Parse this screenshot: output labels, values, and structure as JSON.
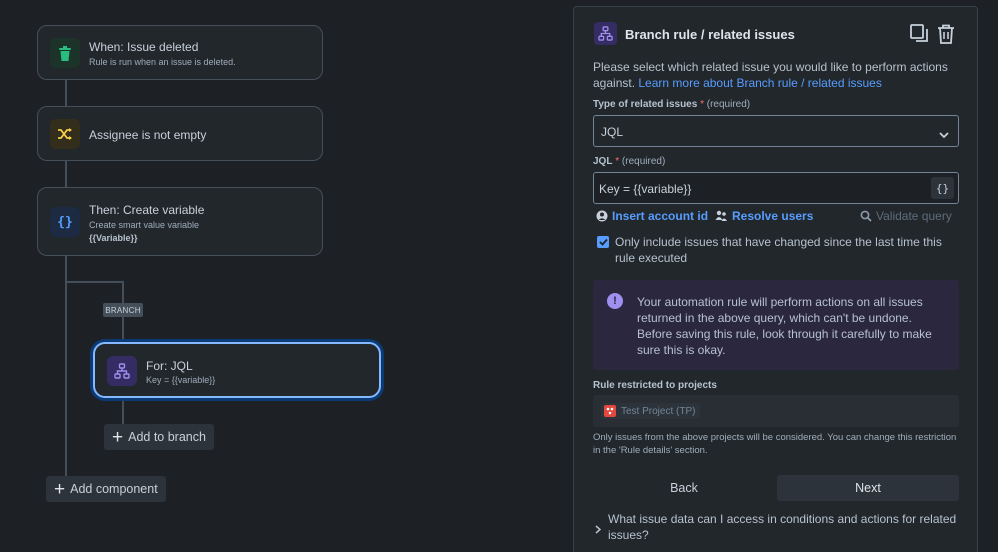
{
  "canvas": {
    "trigger": {
      "title": "When: Issue deleted",
      "subtitle": "Rule is run when an issue is deleted.",
      "icon": "trash-icon",
      "icon_color": "#2abb7f"
    },
    "condition": {
      "title": "Assignee is not empty",
      "icon": "shuffle-icon",
      "icon_color": "#f5cd47"
    },
    "action": {
      "title": "Then: Create variable",
      "subtitle": "Create smart value variable",
      "subtitle2": "{{Variable}}",
      "icon": "braces-icon",
      "icon_color": "#579dff"
    },
    "branch_tag": "BRANCH",
    "branch_node": {
      "title": "For: JQL",
      "subtitle": "Key = {{variable}}",
      "icon": "hierarchy-icon",
      "icon_color": "#9f8fef"
    },
    "add_to_branch": "Add to branch",
    "add_component": "Add component"
  },
  "panel": {
    "title": "Branch rule / related issues",
    "description": "Please select which related issue you would like to perform actions against.",
    "learn_more": "Learn more about Branch rule / related issues",
    "type_label": "Type of related issues",
    "required_star": "*",
    "required_text": "(required)",
    "type_value": "JQL",
    "jql_label": "JQL",
    "jql_value": "Key = {{variable}}",
    "jql_braces": "{}",
    "insert_account": "Insert account id",
    "resolve_users": "Resolve users",
    "validate_query": "Validate query",
    "checkbox_checked": true,
    "checkbox_text": "Only include issues that have changed since the last time this rule executed",
    "info_icon": "!",
    "info_text": "Your automation rule will perform actions on all issues returned in the above query, which can't be undone. Before saving this rule, look through it carefully to make sure this is okay.",
    "projects_label": "Rule restricted to projects",
    "project_chip": "Test Project (TP)",
    "helper_text": "Only issues from the above projects will be considered. You can change this restriction in the 'Rule details' section.",
    "back": "Back",
    "next": "Next",
    "faq": "What issue data can I access in conditions and actions for related issues?"
  },
  "colors": {
    "background": "#1d2125",
    "surface": "#22272b",
    "accent": "#579dff",
    "focus": "#85b8ff",
    "discovery": "#9f8fef"
  }
}
